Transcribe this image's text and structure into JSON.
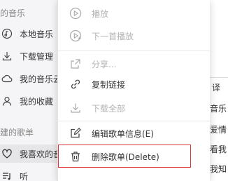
{
  "sidebar": {
    "section_music": "我的音乐",
    "items": [
      {
        "label": "本地音乐",
        "icon": "music-note-icon"
      },
      {
        "label": "下载管理",
        "icon": "download-icon"
      },
      {
        "label": "我的音乐云",
        "icon": "cloud-icon"
      },
      {
        "label": "我的收藏",
        "icon": "user-icon"
      }
    ],
    "section_playlists": "创建的歌单",
    "playlists": [
      {
        "label": "我喜欢的音",
        "icon": "heart-icon"
      },
      {
        "label": "听",
        "icon": "playlist-icon"
      }
    ]
  },
  "context_menu": {
    "items": [
      {
        "label": "播放",
        "icon": "play-icon",
        "enabled": false
      },
      {
        "label": "下一首播放",
        "icon": "play-next-icon",
        "enabled": false
      },
      {
        "label": "分享...",
        "icon": "share-icon",
        "enabled": false
      },
      {
        "label": "复制链接",
        "icon": "link-icon",
        "enabled": true
      },
      {
        "label": "下载全部",
        "icon": "download-icon",
        "enabled": false
      },
      {
        "label": "编辑歌单信息(E)",
        "icon": "edit-icon",
        "enabled": true
      },
      {
        "label": "删除歌单(Delete)",
        "icon": "trash-icon",
        "enabled": true
      }
    ],
    "highlight_color": "#e0343b"
  },
  "right_panel": {
    "tab_label": "译",
    "rows": [
      "音乐",
      "爱情",
      "看我",
      "我知"
    ]
  }
}
